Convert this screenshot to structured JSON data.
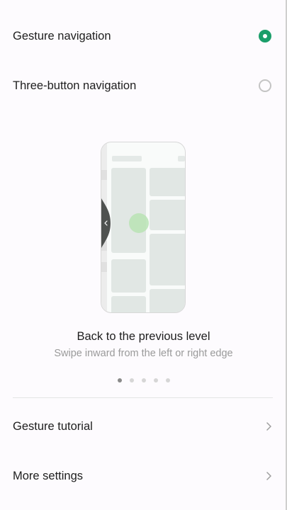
{
  "options": [
    {
      "label": "Gesture navigation",
      "selected": true
    },
    {
      "label": "Three-button navigation",
      "selected": false
    }
  ],
  "illustration": {
    "title": "Back to the previous level",
    "subtitle": "Swipe inward from the left or right edge",
    "page_count": 5,
    "active_page": 1
  },
  "links": [
    {
      "label": "Gesture tutorial",
      "icon": "chevron-right-icon"
    },
    {
      "label": "More settings",
      "icon": "chevron-right-icon"
    }
  ],
  "colors": {
    "accent": "#1a9e6a",
    "background": "#fdfbfe",
    "secondary_text": "#9a9a9a"
  }
}
